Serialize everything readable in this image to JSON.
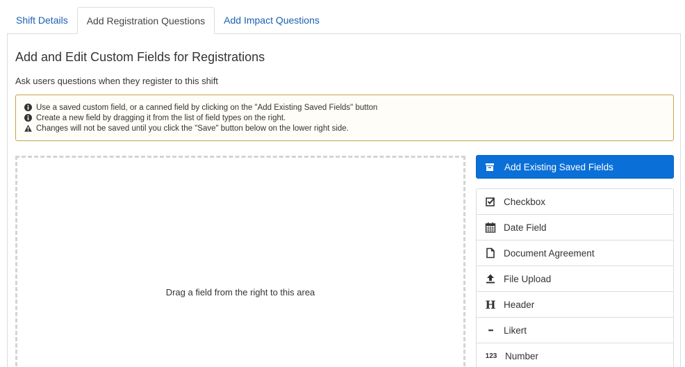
{
  "tabs": [
    {
      "label": "Shift Details",
      "active": false
    },
    {
      "label": "Add Registration Questions",
      "active": true
    },
    {
      "label": "Add Impact Questions",
      "active": false
    }
  ],
  "main": {
    "title": "Add and Edit Custom Fields for Registrations",
    "subtitle": "Ask users questions when they register to this shift",
    "alert": {
      "lines": [
        {
          "icon": "info-icon",
          "text": "Use a saved custom field, or a canned field by clicking on the \"Add Existing Saved Fields\" button"
        },
        {
          "icon": "info-icon",
          "text": "Create a new field by dragging it from the list of field types on the right."
        },
        {
          "icon": "warning-icon",
          "text": "Changes will not be saved until you click the \"Save\" button below on the lower right side."
        }
      ]
    },
    "dropzone_text": "Drag a field from the right to this area"
  },
  "sidebar": {
    "add_saved_label": "Add Existing Saved Fields",
    "add_saved_icon": "archive-box-icon",
    "field_types": [
      {
        "icon": "checkbox-icon",
        "label": "Checkbox"
      },
      {
        "icon": "calendar-icon",
        "label": "Date Field"
      },
      {
        "icon": "document-icon",
        "label": "Document Agreement"
      },
      {
        "icon": "upload-icon",
        "label": "File Upload"
      },
      {
        "icon": "header-icon",
        "label": "Header",
        "glyph": "H"
      },
      {
        "icon": "likert-icon",
        "label": "Likert",
        "glyph": "•••"
      },
      {
        "icon": "number-icon",
        "label": "Number",
        "glyph": "123"
      }
    ]
  },
  "colors": {
    "link": "#1a5fb4",
    "primary_button": "#0b6fd8",
    "alert_border": "#c8a24e"
  }
}
